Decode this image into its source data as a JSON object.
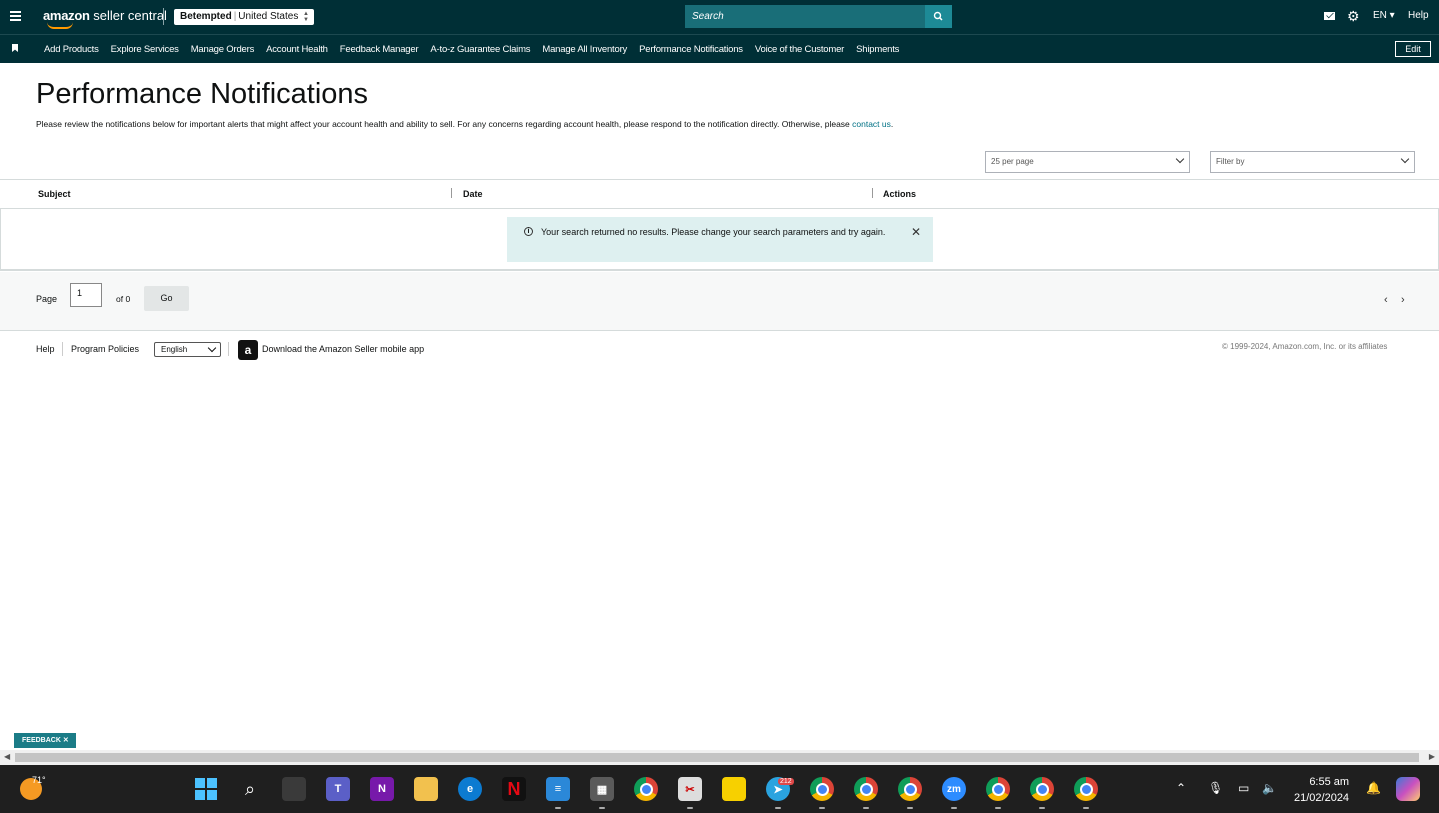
{
  "topbar": {
    "logo_text": "amazon",
    "logo_suffix": "seller central",
    "account_name": "Betempted",
    "account_region": "United States",
    "search_placeholder": "Search",
    "language": "EN",
    "help": "Help"
  },
  "nav": {
    "items": [
      "Add Products",
      "Explore Services",
      "Manage Orders",
      "Account Health",
      "Feedback Manager",
      "A-to-z Guarantee Claims",
      "Manage All Inventory",
      "Performance Notifications",
      "Voice of the Customer",
      "Shipments"
    ],
    "edit": "Edit"
  },
  "page": {
    "title": "Performance Notifications",
    "description": "Please review the notifications below for important alerts that might affect your account health and ability to sell. For any concerns regarding account health, please respond to the notification directly. Otherwise, please ",
    "contact_link": "contact us",
    "description_end": "."
  },
  "filters": {
    "per_page": "25 per page",
    "filter_by": "Filter by"
  },
  "table": {
    "columns": [
      "Subject",
      "Date",
      "Actions"
    ],
    "empty_message": "Your search returned no results. Please change your search parameters and try again."
  },
  "pager": {
    "label": "Page",
    "value": "1",
    "of": "of 0",
    "go": "Go"
  },
  "footer": {
    "help": "Help",
    "policies": "Program Policies",
    "language": "English",
    "app": "Download the Amazon Seller mobile app",
    "copyright": "© 1999-2024, Amazon.com, Inc. or its affiliates"
  },
  "feedback": "FEEDBACK",
  "taskbar": {
    "temperature": "71°",
    "telegram_badge": "212",
    "time": "6:55 am",
    "date": "21/02/2024"
  }
}
